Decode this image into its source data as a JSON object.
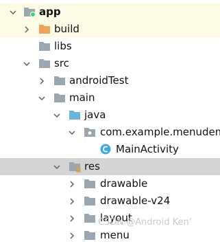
{
  "tree": {
    "rows": [
      {
        "label": "app",
        "icon": "module-folder-icon",
        "expanded": true
      },
      {
        "label": "build",
        "icon": "orange-folder-icon",
        "expanded": false
      },
      {
        "label": "libs",
        "icon": "folder-icon"
      },
      {
        "label": "src",
        "icon": "folder-icon",
        "expanded": true
      },
      {
        "label": "androidTest",
        "icon": "folder-icon",
        "expanded": false
      },
      {
        "label": "main",
        "icon": "folder-icon",
        "expanded": true
      },
      {
        "label": "java",
        "icon": "source-folder-icon",
        "expanded": true
      },
      {
        "label": "com.example.menudem",
        "icon": "package-icon",
        "expanded": true
      },
      {
        "label": "MainActivity",
        "icon": "class-icon"
      },
      {
        "label": "res",
        "icon": "resource-folder-icon",
        "expanded": true
      },
      {
        "label": "drawable",
        "icon": "folder-icon",
        "expanded": false
      },
      {
        "label": "drawable-v24",
        "icon": "folder-icon",
        "expanded": false
      },
      {
        "label": "layout",
        "icon": "folder-icon",
        "expanded": false
      },
      {
        "label": "menu",
        "icon": "folder-icon",
        "expanded": false
      }
    ]
  },
  "watermark": "CSDN @Android Ken'",
  "colors": {
    "selected_row": "#fdfbe6",
    "focused_row": "#d4d4d4",
    "folder": "#9aa7b0",
    "excluded_folder": "#f0a15a",
    "source_folder": "#6ab4e0",
    "class_badge": "#3fa9e4"
  }
}
